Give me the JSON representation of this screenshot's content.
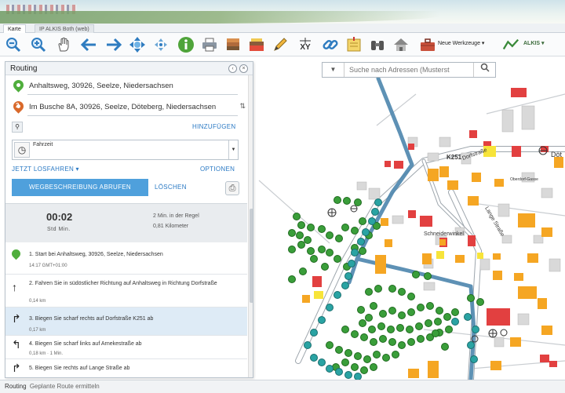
{
  "tabs": [
    {
      "label": "Karte",
      "active": true
    },
    {
      "label": "IP ALKIS Both (web)",
      "active": false
    }
  ],
  "toolbar": {
    "icons": [
      "zoom-out-icon",
      "zoom-in-icon",
      "pan-hand-icon",
      "back-arrow-icon",
      "forward-arrow-icon",
      "full-extent-icon",
      "center-icon",
      "info-icon",
      "print-icon",
      "layers-icon",
      "measure-icon",
      "pencil-icon",
      "xy-coordinates-icon",
      "link-icon",
      "map-note-icon",
      "binoculars-icon",
      "home-icon"
    ],
    "xy_label": "XY",
    "tools_label": "Neue Werkzeuge",
    "alkis_label": "ALKIS"
  },
  "panel": {
    "title": "Routing",
    "waypoints": [
      {
        "index": "",
        "text": "Anhaltsweg, 30926, Seelze, Niedersachsen",
        "color": "#4fae3c"
      },
      {
        "index": "2",
        "text": "Im Busche 8A, 30926, Seelze, Döteberg, Niedersachsen",
        "color": "#d9692b"
      }
    ],
    "add_label": "HINZUFÜGEN",
    "mode_label": "Fahrzeit",
    "start_label": "JETZT LOSFAHREN ▾",
    "options_label": "OPTIONEN",
    "route_button": "WEGBESCHREIBUNG ABRUFEN",
    "clear_button": "LÖSCHEN",
    "summary": {
      "time": "00:02",
      "units": "Std  Min.",
      "regular": "2 Min. in der Regel",
      "distance": "0,81 Kilometer"
    },
    "steps": [
      {
        "icon": "start-pin-icon",
        "text": "1. Start bei Anhaltsweg, 30926, Seelze, Niedersachsen",
        "dist": "14:17 GMT+01:00",
        "selected": false
      },
      {
        "icon": "straight-arrow-icon",
        "text": "2. Fahren Sie in südöstlicher Richtung auf Anhaltsweg in Richtung Dorfstraße",
        "dist": "0,14 km",
        "selected": false
      },
      {
        "icon": "turn-right-icon",
        "text": "3. Biegen Sie scharf rechts auf Dorfstraße K251 ab",
        "dist": "0,17 km",
        "selected": true
      },
      {
        "icon": "turn-left-icon",
        "text": "4. Biegen Sie scharf links auf Arnekestraße ab",
        "dist": "0,18 km · 1 Min.",
        "selected": false
      },
      {
        "icon": "turn-right-icon",
        "text": "5. Biegen Sie rechts auf Lange Straße ab",
        "dist": "",
        "selected": false
      }
    ]
  },
  "search": {
    "placeholder": "Suche nach Adressen (Musterst"
  },
  "map": {
    "labels": [
      "K251",
      "Dorfstraße",
      "Schneiderwinkel",
      "Lange Straße",
      "Oberdorf-Gasse",
      "Döt"
    ]
  },
  "status": {
    "label": "Routing",
    "sub": "Geplante Route ermitteln"
  }
}
